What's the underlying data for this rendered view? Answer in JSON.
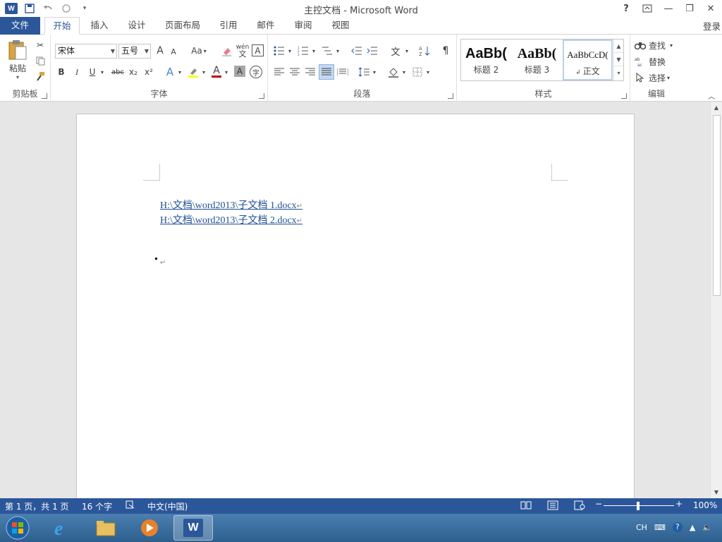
{
  "title": "主控文档 - Microsoft Word",
  "colors": {
    "accent": "#2b579a",
    "link": "#1f4e96"
  },
  "tabs": [
    {
      "label": "文件"
    },
    {
      "label": "开始"
    },
    {
      "label": "插入"
    },
    {
      "label": "设计"
    },
    {
      "label": "页面布局"
    },
    {
      "label": "引用"
    },
    {
      "label": "邮件"
    },
    {
      "label": "审阅"
    },
    {
      "label": "视图"
    }
  ],
  "login": "登录",
  "window_controls": {
    "help": "?",
    "min": "—",
    "restore": "❐",
    "close": "✕"
  },
  "ribbon": {
    "clipboard": {
      "label": "剪贴板",
      "paste": "粘贴"
    },
    "font": {
      "label": "字体",
      "font_name": "宋体",
      "font_size": "五号",
      "change_case": "Aa",
      "bold": "B",
      "italic": "I",
      "underline": "U",
      "strike": "abc",
      "sub": "x₂",
      "sup": "x²",
      "grow": "A",
      "shrink": "A",
      "phonetic": "wén",
      "font_color": "A",
      "shade": "A"
    },
    "paragraph": {
      "label": "段落"
    },
    "styles": {
      "label": "样式",
      "items": [
        {
          "preview": "AaBb(",
          "name": "标题 2"
        },
        {
          "preview": "AaBb(",
          "name": "标题 3"
        },
        {
          "preview": "AaBbCcD(",
          "name": "正文"
        }
      ]
    },
    "editing": {
      "label": "编辑",
      "find": "查找",
      "replace": "替换",
      "select": "选择"
    }
  },
  "document": {
    "links": [
      "H:\\文档\\word2013\\子文档 1.docx",
      "H:\\文档\\word2013\\子文档 2.docx"
    ],
    "return_mark": "↵"
  },
  "status": {
    "page": "第 1 页，共 1 页",
    "words": "16 个字",
    "language": "中文(中国)",
    "zoom": "100%"
  },
  "taskbar": {
    "ime": "CH"
  }
}
